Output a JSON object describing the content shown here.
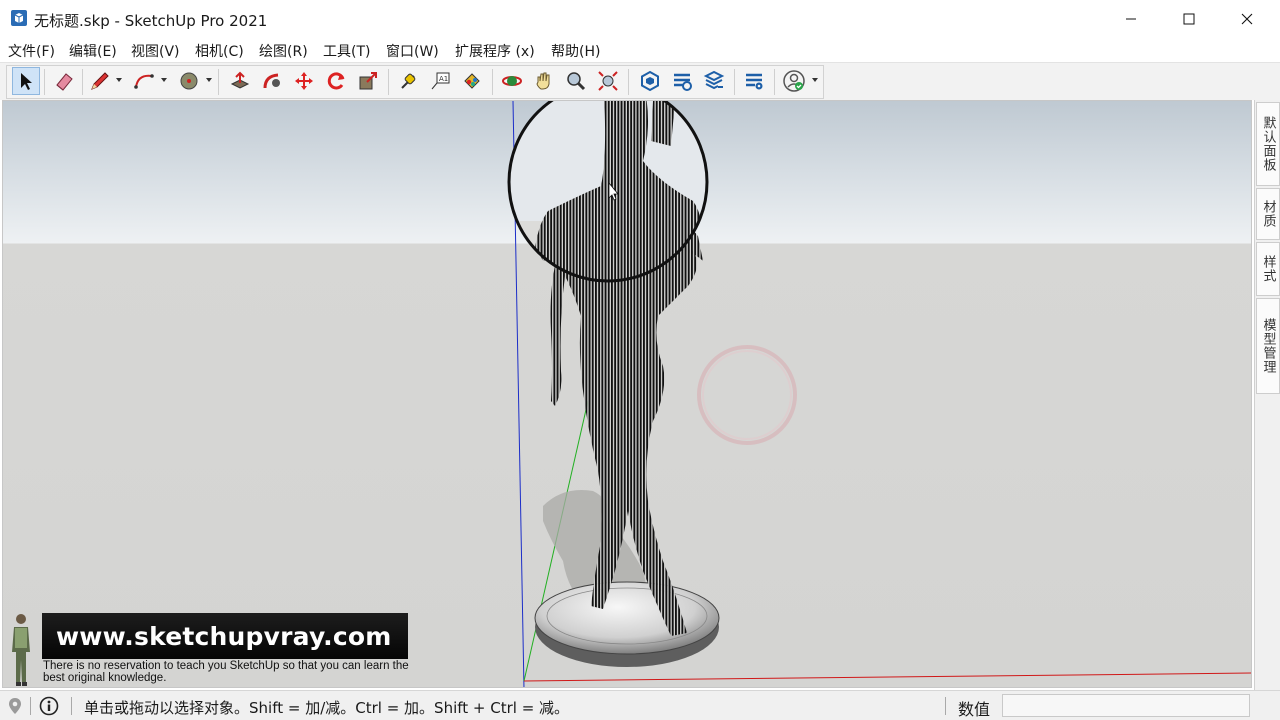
{
  "window": {
    "title": "无标题.skp - SketchUp Pro 2021",
    "controls": [
      "minimize",
      "maximize",
      "close"
    ]
  },
  "menu": {
    "items": [
      {
        "label": "文件(F)"
      },
      {
        "label": "编辑(E)"
      },
      {
        "label": "视图(V)"
      },
      {
        "label": "相机(C)"
      },
      {
        "label": "绘图(R)"
      },
      {
        "label": "工具(T)"
      },
      {
        "label": "窗口(W)"
      },
      {
        "label": "扩展程序 (x)"
      },
      {
        "label": "帮助(H)"
      }
    ]
  },
  "toolbar": {
    "tools": [
      {
        "icon": "select-arrow-icon",
        "active": true
      },
      {
        "icon": "eraser-icon"
      },
      {
        "icon": "pencil-line-icon",
        "dropdown": true
      },
      {
        "icon": "arc-icon",
        "dropdown": true
      },
      {
        "icon": "circle-shape-icon",
        "dropdown": true
      },
      {
        "icon": "push-pull-icon"
      },
      {
        "icon": "follow-me-icon"
      },
      {
        "icon": "move-icon"
      },
      {
        "icon": "rotate-icon"
      },
      {
        "icon": "scale-icon"
      },
      {
        "icon": "tape-measure-icon"
      },
      {
        "icon": "text-label-icon"
      },
      {
        "icon": "paint-bucket-icon"
      },
      {
        "icon": "orbit-icon"
      },
      {
        "icon": "pan-hand-icon"
      },
      {
        "icon": "zoom-icon"
      },
      {
        "icon": "zoom-extents-icon"
      },
      {
        "icon": "warehouse-icon"
      },
      {
        "icon": "extension-warehouse-icon"
      },
      {
        "icon": "share-model-icon"
      },
      {
        "icon": "extension-manager-icon"
      },
      {
        "icon": "account-icon",
        "dropdown": true
      }
    ]
  },
  "tray": {
    "tabs": [
      {
        "label": "默认面板"
      },
      {
        "label": "材质"
      },
      {
        "label": "样式"
      },
      {
        "label": "模型管理"
      }
    ]
  },
  "watermark": {
    "url": "www.sketchupvray.com",
    "tagline": "There is no reservation to teach you SketchUp so that you can learn the best original knowledge."
  },
  "status": {
    "hint": "单击或拖动以选择对象。Shift = 加/减。Ctrl = 加。Shift + Ctrl = 减。",
    "measure_label": "数值",
    "measure_value": ""
  },
  "colors": {
    "sky": "#d6dde3",
    "ground": "#d4d4d2",
    "axis_red": "#d01818",
    "axis_green": "#21b021",
    "axis_blue": "#1c2ec8",
    "selection_highlight": "#cfe3f7"
  }
}
